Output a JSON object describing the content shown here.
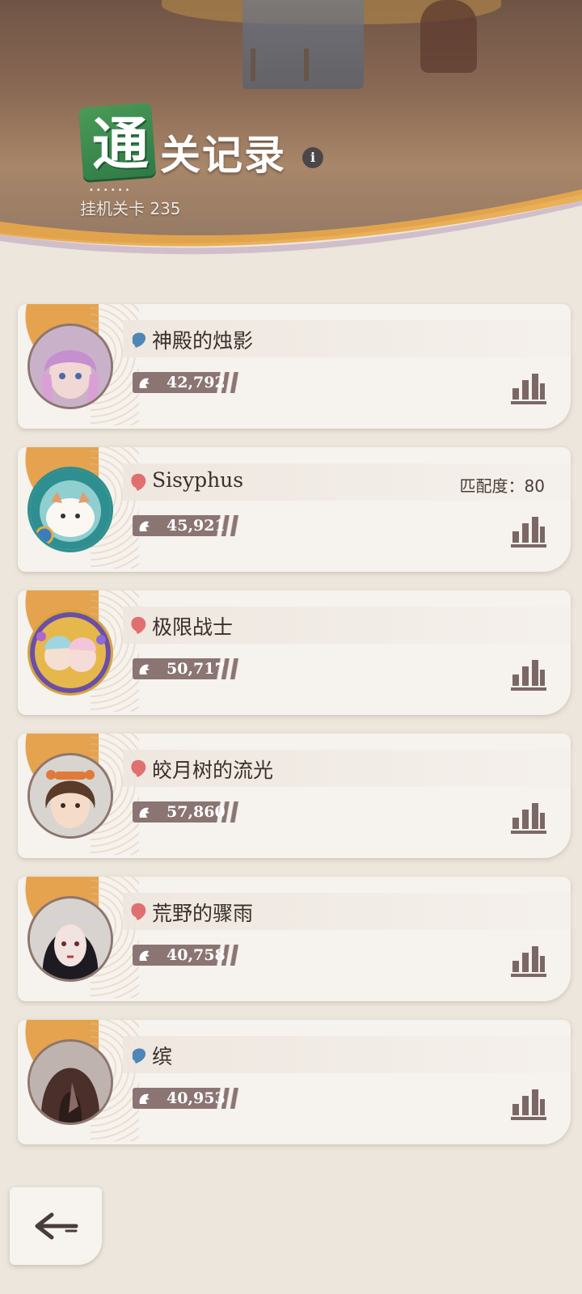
{
  "header": {
    "logo_char": "通",
    "title": "关记录",
    "stage_label": "挂机关卡 235",
    "dots": "••••••"
  },
  "players": [
    {
      "name": "神殿的烛影",
      "gender": "male",
      "power": "42,792",
      "match": null,
      "avatar": "purple-hair-girl"
    },
    {
      "name": "Sisyphus",
      "gender": "female",
      "power": "45,921",
      "match": "匹配度：80",
      "avatar": "white-cat-frame"
    },
    {
      "name": "极限战士",
      "gender": "female",
      "power": "50,717",
      "match": null,
      "avatar": "twins-gold-frame"
    },
    {
      "name": "皎月树的流光",
      "gender": "female",
      "power": "57,860",
      "match": null,
      "avatar": "brown-hair-girl"
    },
    {
      "name": "荒野的骤雨",
      "gender": "female",
      "power": "40,758",
      "match": null,
      "avatar": "black-hair-lady"
    },
    {
      "name": "缤",
      "gender": "male",
      "power": "40,953",
      "match": null,
      "avatar": "hooded-figure"
    }
  ],
  "colors": {
    "male_icon": "#4f86b8",
    "female_icon": "#e07070",
    "power_bar": "#8a7573",
    "accent_orange": "#e39a3d"
  }
}
